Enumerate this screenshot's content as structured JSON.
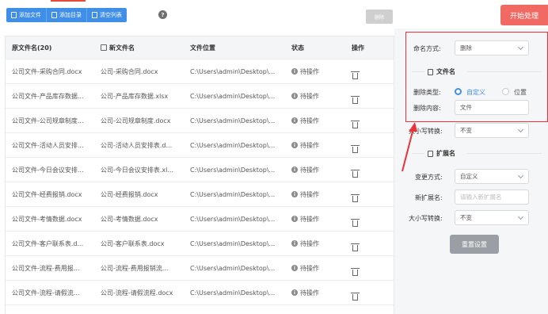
{
  "toolbar": {
    "add_file": "添加文件",
    "add_folder": "添加目录",
    "clear_list": "清空列表",
    "help": "?"
  },
  "delete_button": "删除",
  "start_button": "开始处理",
  "table": {
    "headers": {
      "original": "原文件名(20)",
      "new": "新文件名",
      "location": "文件位置",
      "status": "状态",
      "operation": "操作"
    },
    "rows": [
      {
        "original": "公司文件-采购合同.docx",
        "new": "公司-采购合同.docx",
        "location": "C:\\Users\\admin\\Desktop\\...",
        "status": "待操作"
      },
      {
        "original": "公司文件-产品库存数据...",
        "new": "公司-产品库存数据.xlsx",
        "location": "C:\\Users\\admin\\Desktop\\...",
        "status": "待操作"
      },
      {
        "original": "公司文件-公司规章制度...",
        "new": "公司-公司规章制度.docx",
        "location": "C:\\Users\\admin\\Desktop\\...",
        "status": "待操作"
      },
      {
        "original": "公司文件-活动人员安排...",
        "new": "公司-活动人员安排表.d...",
        "location": "C:\\Users\\admin\\Desktop\\...",
        "status": "待操作"
      },
      {
        "original": "公司文件-今日会议安排...",
        "new": "公司-今日会议安排表.xl...",
        "location": "C:\\Users\\admin\\Desktop\\...",
        "status": "待操作"
      },
      {
        "original": "公司文件-经费报销.docx",
        "new": "公司-经费报销.docx",
        "location": "C:\\Users\\admin\\Desktop\\...",
        "status": "待操作"
      },
      {
        "original": "公司文件-考情数据.docx",
        "new": "公司-考情数据.docx",
        "location": "C:\\Users\\admin\\Desktop\\...",
        "status": "待操作"
      },
      {
        "original": "公司文件-客户联系表.d...",
        "new": "公司-客户联系表.docx",
        "location": "C:\\Users\\admin\\Desktop\\...",
        "status": "待操作"
      },
      {
        "original": "公司文件-流程-费用报...",
        "new": "公司-流程-费用报销流...",
        "location": "C:\\Users\\admin\\Desktop\\...",
        "status": "待操作"
      },
      {
        "original": "公司文件-流程-请假流...",
        "new": "公司-流程-请假流程.docx",
        "location": "C:\\Users\\admin\\Desktop\\...",
        "status": "待操作"
      }
    ]
  },
  "panel": {
    "naming_label": "命名方式:",
    "naming_value": "删除",
    "filename_section": "文件名",
    "delete_type_label": "删除类型:",
    "delete_type_custom": "自定义",
    "delete_type_position": "位置",
    "delete_content_label": "删除内容:",
    "delete_content_value": "文件",
    "case_label": "大小写转换:",
    "case_value": "不变",
    "ext_section": "扩展名",
    "change_label": "变更方式:",
    "change_value": "自定义",
    "new_ext_label": "新扩展名:",
    "new_ext_placeholder": "请输入新扩展名",
    "case2_label": "大小写转换:",
    "case2_value": "不变",
    "reset_button": "重置设置"
  },
  "colors": {
    "primary": "#3f8ee8",
    "start": "#f06a63",
    "highlight": "#e8323c"
  }
}
